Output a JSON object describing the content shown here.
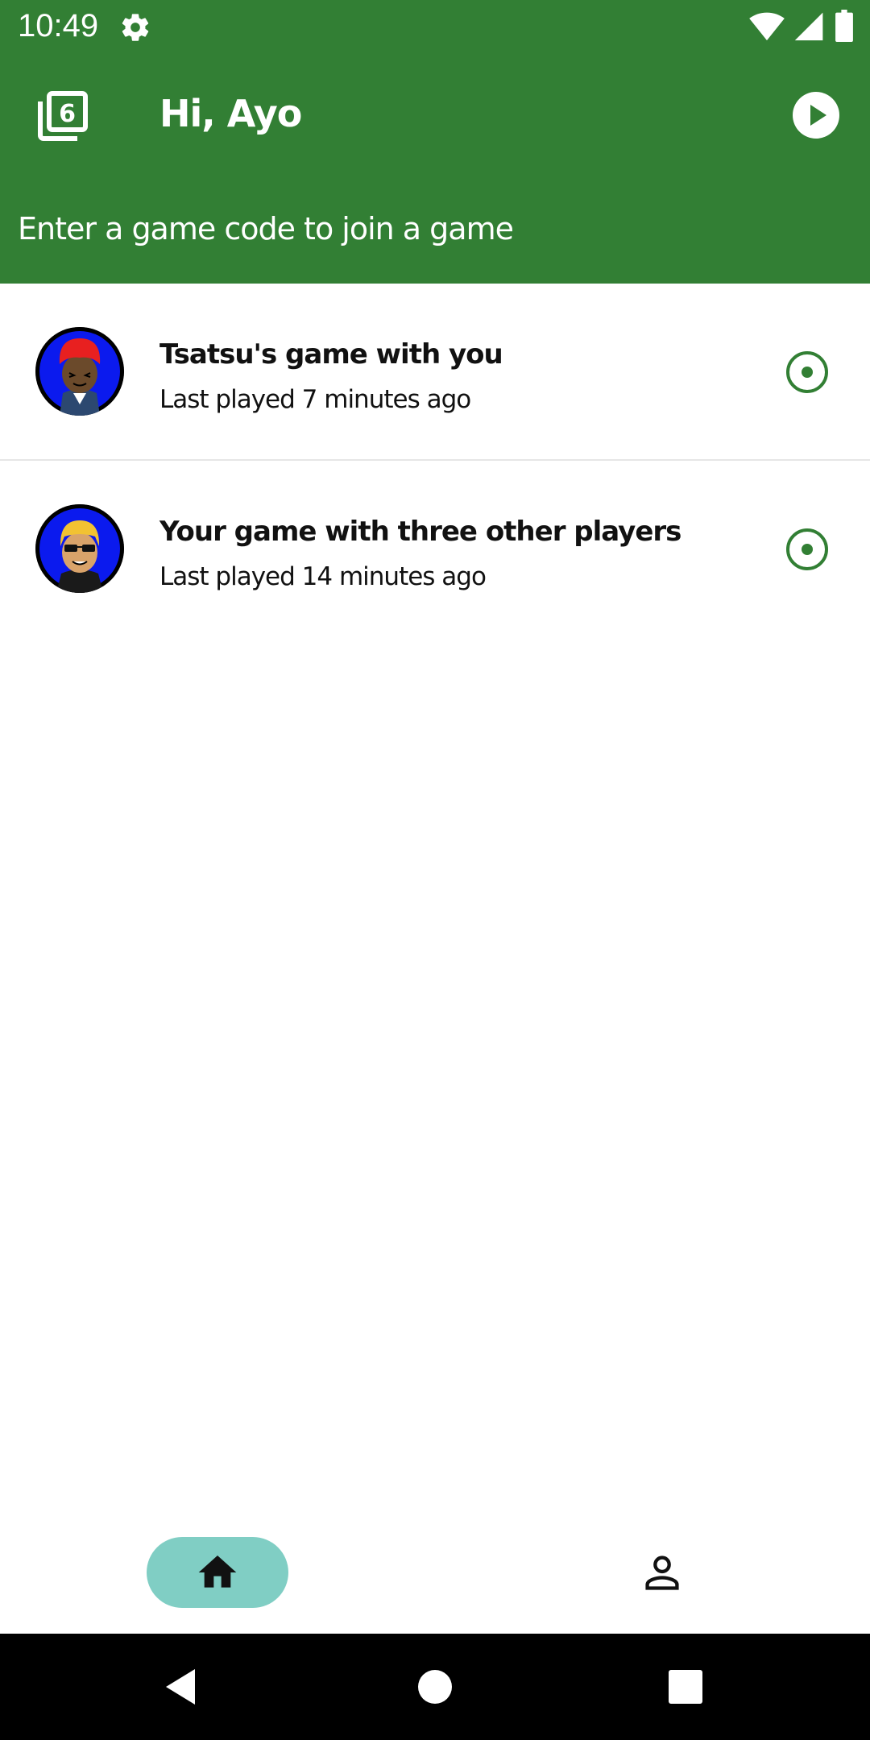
{
  "status_bar": {
    "time": "10:49",
    "icons": [
      "settings-gear-icon",
      "wifi-icon",
      "signal-icon",
      "battery-icon"
    ]
  },
  "header": {
    "title": "Hi, Ayo",
    "join_prompt": "Enter a game code to join a game",
    "left_icon": "game-library-icon",
    "right_icon": "play-icon",
    "background_color": "#327f34"
  },
  "games": [
    {
      "title": "Tsatsu's game with you",
      "subtitle": "Last played 7 minutes ago",
      "avatar": "red-haired-player-avatar"
    },
    {
      "title": "Your game with three other players",
      "subtitle": "Last played 14 minutes ago",
      "avatar": "blonde-sunglasses-player-avatar"
    }
  ],
  "bottom_nav": {
    "items": [
      {
        "icon": "home-icon",
        "selected": true
      },
      {
        "icon": "profile-icon",
        "selected": false
      }
    ],
    "selected_color": "#80cec4"
  },
  "system_nav": {
    "buttons": [
      "back-icon",
      "home-circle-icon",
      "recents-icon"
    ]
  }
}
